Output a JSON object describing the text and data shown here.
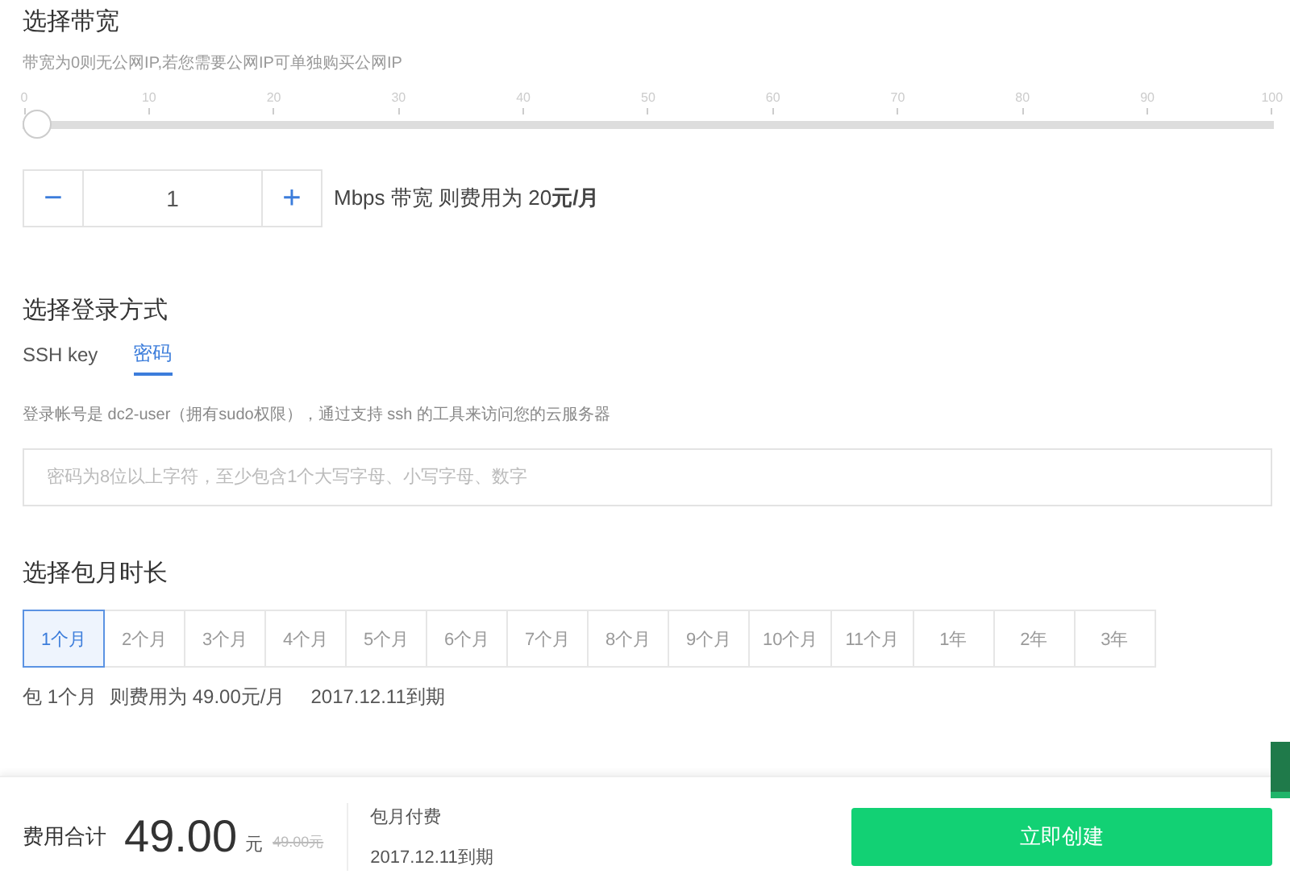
{
  "bandwidth": {
    "title": "选择带宽",
    "hint": "带宽为0则无公网IP,若您需要公网IP可单独购买公网IP",
    "slider": {
      "level": 0,
      "ticks": [
        "0",
        "10",
        "20",
        "30",
        "40",
        "50",
        "60",
        "70",
        "80",
        "90",
        "100"
      ]
    },
    "stepper": {
      "minus": "−",
      "value": "1",
      "plus": "+"
    },
    "cost_text": "Mbps 带宽 则费用为 20**元/月**"
  },
  "login": {
    "title": "选择登录方式",
    "tabs": [
      {
        "label": "SSH key",
        "selected": false
      },
      {
        "label": "密码",
        "selected": true
      }
    ],
    "note": "登录帐号是 dc2-user（拥有sudo权限），通过支持 ssh 的工具来访问您的云服务器",
    "password": {
      "placeholder": "密码为8位以上字符，至少包含1个大写字母、小写字母、数字"
    }
  },
  "duration": {
    "title": "选择包月时长",
    "options": [
      {
        "label": "1个月",
        "selected": true
      },
      {
        "label": "2个月",
        "selected": false
      },
      {
        "label": "3个月",
        "selected": false
      },
      {
        "label": "4个月",
        "selected": false
      },
      {
        "label": "5个月",
        "selected": false
      },
      {
        "label": "6个月",
        "selected": false
      },
      {
        "label": "7个月",
        "selected": false
      },
      {
        "label": "8个月",
        "selected": false
      },
      {
        "label": "9个月",
        "selected": false
      },
      {
        "label": "10个月",
        "selected": false
      },
      {
        "label": "11个月",
        "selected": false
      },
      {
        "label": "1年",
        "selected": false
      },
      {
        "label": "2年",
        "selected": false
      },
      {
        "label": "3年",
        "selected": false
      }
    ],
    "summary": [
      "包 1个月",
      "则费用为 49.00元/月",
      "2017.12.11到期"
    ]
  },
  "footer": {
    "total_label": "费用合计",
    "amount": "49.00",
    "unit": "元",
    "original_price": "49.00元",
    "billing": "包月付费",
    "expiry": "2017.12.11到期",
    "create_button": "立即创建"
  }
}
